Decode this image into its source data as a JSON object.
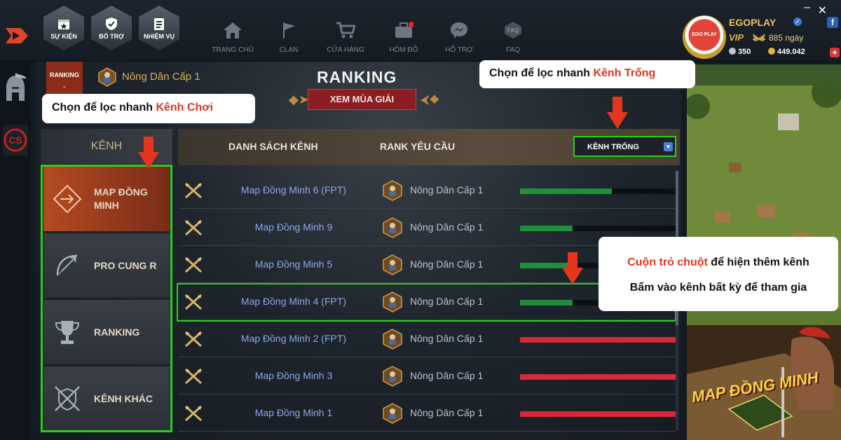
{
  "top_buttons": [
    {
      "label": "SỰ KIỆN",
      "icon": "calendar-star-icon"
    },
    {
      "label": "BỔ TRỢ",
      "icon": "shield-check-icon"
    },
    {
      "label": "NHIỆM VỤ",
      "icon": "checklist-icon"
    }
  ],
  "nav": [
    {
      "label": "TRANG CHỦ",
      "icon": "home-icon"
    },
    {
      "label": "CLAN",
      "icon": "flag-icon"
    },
    {
      "label": "CỬA HÀNG",
      "icon": "cart-icon"
    },
    {
      "label": "HÒM ĐỒ",
      "icon": "chest-icon"
    },
    {
      "label": "HỖ TRỢ",
      "icon": "messenger-icon"
    },
    {
      "label": "FAQ",
      "icon": "faq-icon"
    }
  ],
  "window": {
    "minimize": "–",
    "close": "✕"
  },
  "profile": {
    "name": "EGOPLAY",
    "avatar_text": "EGO PLAY",
    "vip": "VIP",
    "days": "885 ngày",
    "coin_silver": "350",
    "coin_gold": "449.042",
    "plus": "+",
    "fb": "f"
  },
  "header": {
    "rank_tab": "RANKING",
    "level": "Nông Dân Cấp 1",
    "title": "RANKING",
    "season_button": "XEM MÙA GIẢI"
  },
  "categories": {
    "heading": "KÊNH",
    "items": [
      {
        "label": "MAP ĐỒNG MINH",
        "active": true
      },
      {
        "label": "PRO CUNG R",
        "active": false
      },
      {
        "label": "RANKING",
        "active": false
      },
      {
        "label": "KÊNH KHÁC",
        "active": false
      }
    ]
  },
  "table": {
    "col_list": "DANH SÁCH KÊNH",
    "col_rank": "RANK YÊU CẦU",
    "filter": "KÊNH TRỐNG",
    "rows": [
      {
        "name": "Map Đồng Minh 6 (FPT)",
        "rank": "Nông Dân Cấp 1",
        "fill": 0.59,
        "status": "green"
      },
      {
        "name": "Map Đồng Minh 9",
        "rank": "Nông Dân Cấp 1",
        "fill": 0.34,
        "status": "green"
      },
      {
        "name": "Map Đồng Minh 5",
        "rank": "Nông Dân Cấp 1",
        "fill": 0.34,
        "status": "green"
      },
      {
        "name": "Map Đồng Minh 4 (FPT)",
        "rank": "Nông Dân Cấp 1",
        "fill": 0.34,
        "status": "green"
      },
      {
        "name": "Map Đồng Minh 2 (FPT)",
        "rank": "Nông Dân Cấp 1",
        "fill": 1.0,
        "status": "red"
      },
      {
        "name": "Map Đồng Minh 3",
        "rank": "Nông Dân Cấp 1",
        "fill": 1.0,
        "status": "red"
      },
      {
        "name": "Map Đồng Minh 1",
        "rank": "Nông Dân Cấp 1",
        "fill": 1.0,
        "status": "red"
      }
    ]
  },
  "promo": {
    "text": "MAP ĐỒNG MINH"
  },
  "callouts": {
    "c1_prefix": "Chọn để lọc nhanh ",
    "c1_highlight": "Kênh Chơi",
    "c2_prefix": "Chọn để lọc nhanh ",
    "c2_highlight": "Kênh Trống",
    "c3_highlight": "Cuộn trỏ chuột",
    "c3_suffix": " để hiện thêm kênh",
    "c3_line2": "Bấm vào kênh bất kỳ để tham gia"
  },
  "colors": {
    "green": "#1f8f3a",
    "red": "#d8283a",
    "accent_outline": "#27d11b",
    "callout_red": "#e2361f"
  }
}
